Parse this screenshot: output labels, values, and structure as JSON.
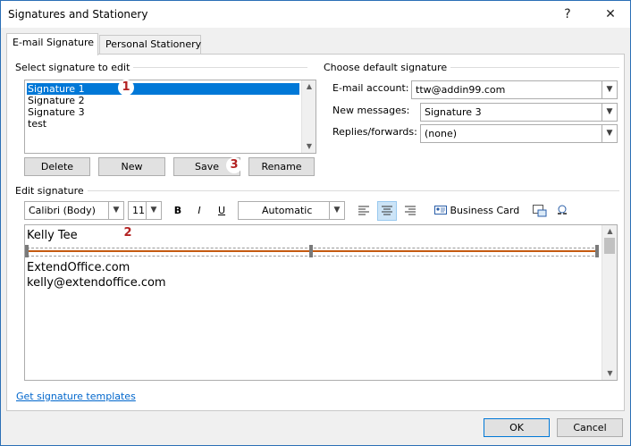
{
  "window": {
    "title": "Signatures and Stationery",
    "help": "?",
    "close": "✕"
  },
  "tabs": [
    {
      "label": "E-mail Signature",
      "key": "E"
    },
    {
      "label": "Personal Stationery",
      "key": "P"
    }
  ],
  "select": {
    "label": "Select signature to edit",
    "items": [
      "Signature 1",
      "Signature 2",
      "Signature 3",
      "test"
    ]
  },
  "actions": {
    "delete": "Delete",
    "new": "New",
    "save": "Save",
    "rename": "Rename"
  },
  "defaults": {
    "label": "Choose default signature",
    "email_account_label": "E-mail account:",
    "email_account": "ttw@addin99.com",
    "new_messages_label": "New messages:",
    "new_messages": "Signature 3",
    "replies_label": "Replies/forwards:",
    "replies": "(none)"
  },
  "edit": {
    "label": "Edit signature",
    "font": "Calibri (Body)",
    "size": "11",
    "bold": "B",
    "italic": "I",
    "underline": "U",
    "color": "Automatic",
    "business_card": "Business Card",
    "lines": [
      "Kelly Tee",
      "ExtendOffice.com",
      "kelly@extendoffice.com"
    ],
    "accent_color": "#c55a11"
  },
  "badges": [
    "1",
    "2",
    "3"
  ],
  "link": "Get signature templates",
  "footer": {
    "ok": "OK",
    "cancel": "Cancel"
  }
}
